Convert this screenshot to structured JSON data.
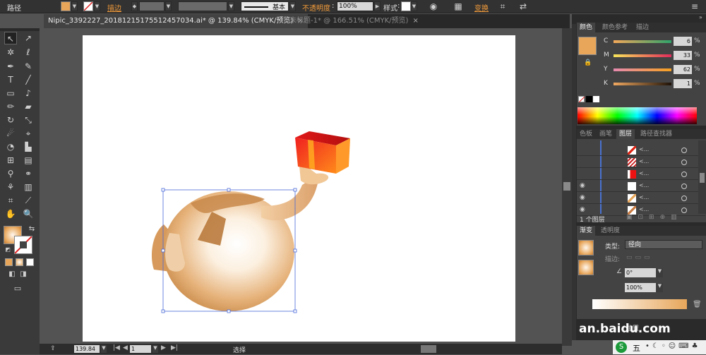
{
  "control_bar": {
    "object_type": "路径",
    "stroke_label": "描边",
    "brush_label": "基本",
    "opacity_label": "不透明度",
    "opacity_value": "100%",
    "style_label": "样式",
    "transform_label": "变换"
  },
  "document_tabs": [
    {
      "label": "Nipic_3392227_20181215175512457034.ai* @ 139.84% (CMYK/预览)",
      "close": "×"
    },
    {
      "label": "未标题-1* @ 166.51% (CMYK/预览)",
      "close": "×"
    }
  ],
  "color_panel": {
    "tabs": [
      "颜色",
      "颜色参考",
      "描边"
    ],
    "channels": [
      {
        "key": "C",
        "value": "6",
        "unit": "%"
      },
      {
        "key": "M",
        "value": "33",
        "unit": "%"
      },
      {
        "key": "Y",
        "value": "62",
        "unit": "%"
      },
      {
        "key": "K",
        "value": "1",
        "unit": "%"
      }
    ],
    "fill_color": "#e7a65a"
  },
  "layers_panel": {
    "tabs": [
      "色板",
      "画笔",
      "图层",
      "路径查找器"
    ],
    "row_label": "<...",
    "footer": "1 个图层"
  },
  "gradient_panel": {
    "tabs": [
      "渐变",
      "透明度"
    ],
    "type_label": "类型:",
    "type_value": "径向",
    "stroke_label": "描边:",
    "angle_value": "0°",
    "aspect_value": "100%",
    "position_label": "位置"
  },
  "status_bar": {
    "zoom": "139.84",
    "artboard": "1",
    "tool": "选择"
  },
  "taskbar": {
    "ime": "五"
  },
  "watermark": "an.baidu.com",
  "colors": {
    "accent_orange": "#f09a3a",
    "ui_dark": "#323232",
    "panel_gray": "#434343"
  }
}
